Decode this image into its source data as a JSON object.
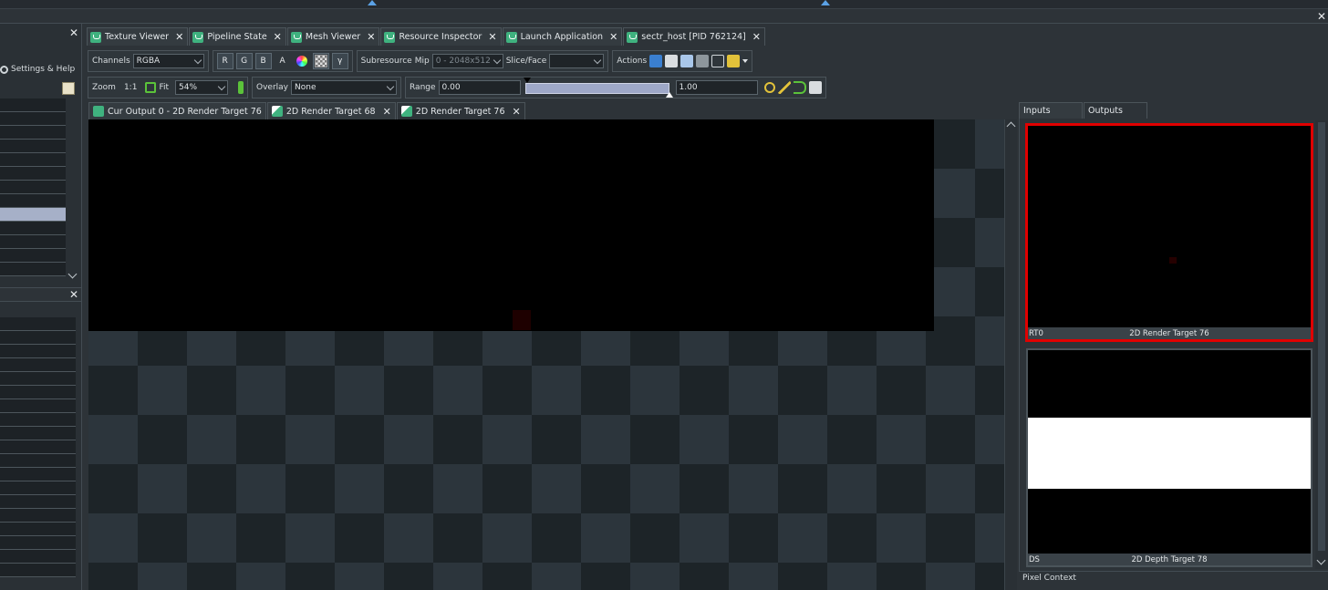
{
  "tabs": [
    {
      "label": "Texture Viewer"
    },
    {
      "label": "Pipeline State"
    },
    {
      "label": "Mesh Viewer"
    },
    {
      "label": "Resource Inspector"
    },
    {
      "label": "Launch Application"
    },
    {
      "label": "sectr_host [PID 762124]"
    }
  ],
  "left": {
    "settings_label": "Settings & Help"
  },
  "toolbar": {
    "channels_label": "Channels",
    "channels_value": "RGBA",
    "r": "R",
    "g": "G",
    "b": "B",
    "a": "A",
    "gamma": "γ",
    "subresource_label": "Subresource",
    "mip_label": "Mip",
    "mip_value": "0 - 2048x512",
    "slice_label": "Slice/Face",
    "slice_value": "",
    "actions_label": "Actions",
    "zoom_label": "Zoom",
    "zoom_1to1": "1:1",
    "fit_label": "Fit",
    "zoom_value": "54%",
    "overlay_label": "Overlay",
    "overlay_value": "None",
    "range_label": "Range",
    "range_min": "0.00",
    "range_max": "1.00"
  },
  "subtabs": [
    {
      "label": "Cur Output 0 - 2D Render Target 76"
    },
    {
      "label": "2D Render Target 68"
    },
    {
      "label": "2D Render Target 76"
    }
  ],
  "right": {
    "tab_inputs": "Inputs",
    "tab_outputs": "Outputs",
    "thumbs": [
      {
        "slot": "RT0",
        "name": "2D Render Target 76"
      },
      {
        "slot": "DS",
        "name": "2D Depth Target 78"
      }
    ],
    "pixel_context": "Pixel Context"
  },
  "colors": {
    "selected_outline": "#e00000",
    "tab_icon": "#3fb27f",
    "range_fill": "#9ea8c8"
  }
}
